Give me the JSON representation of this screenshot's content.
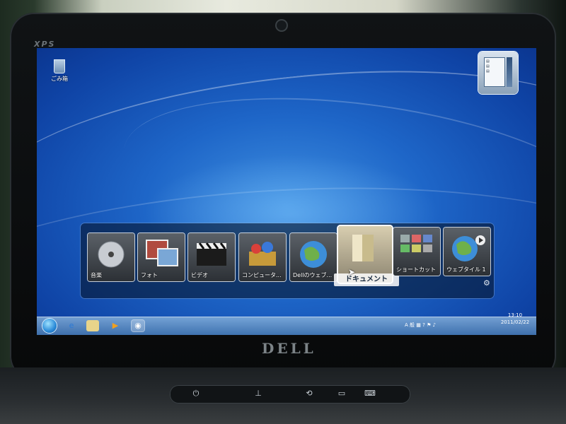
{
  "device": {
    "model_mark": "XPS",
    "brand": "DELL"
  },
  "desktop": {
    "recycle_bin_label": "ごみ箱"
  },
  "dock": {
    "tiles": [
      {
        "label": "音楽",
        "icon": "music-disc-icon"
      },
      {
        "label": "フォト",
        "icon": "photo-icon"
      },
      {
        "label": "ビデオ",
        "icon": "clapper-icon"
      },
      {
        "label": "コンピュータ...",
        "icon": "computer-icon"
      },
      {
        "label": "Dellのウェブ...",
        "icon": "globe-icon"
      },
      {
        "label": "ドキュメント",
        "icon": "folder-icon"
      },
      {
        "label": "ショートカット",
        "icon": "shortcut-grid-icon"
      },
      {
        "label": "ウェブタイル 1",
        "icon": "globe-play-icon"
      }
    ],
    "active_index": 5
  },
  "taskbar": {
    "tray_text": "A 般 ",
    "clock_time": "13:10",
    "clock_date": "2011/02/22"
  },
  "colors": {
    "desktop_blue": "#1e66c8",
    "taskbar": "#5a90c8"
  }
}
